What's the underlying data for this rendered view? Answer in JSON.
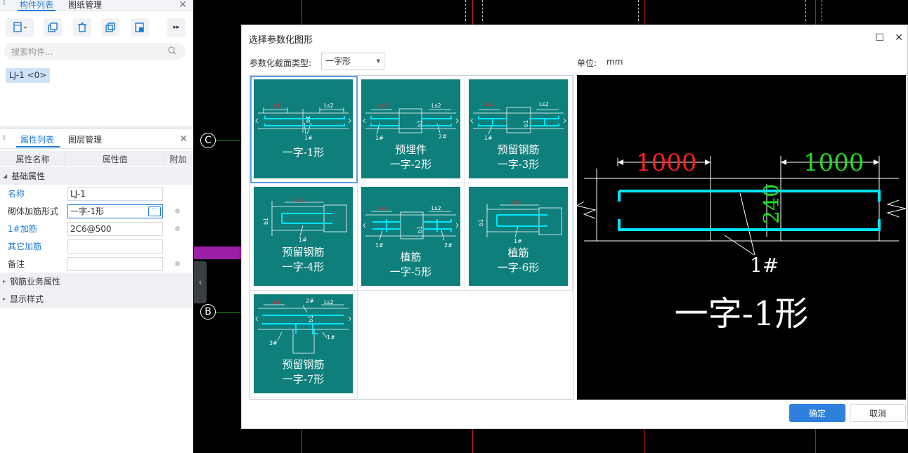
{
  "left_panel": {
    "top_tabs": [
      "构件列表",
      "图纸管理"
    ],
    "search_placeholder": "搜索构件...",
    "component_tag": "LJ-1 <0>",
    "prop_tabs": [
      "属性列表",
      "图层管理"
    ],
    "table_headers": [
      "属性名称",
      "属性值",
      "附加"
    ],
    "group_basic": "基础属性",
    "properties": [
      {
        "name": "名称",
        "value": "LJ-1",
        "highlight": true
      },
      {
        "name": "砌体加筋形式",
        "value": "一字-1形",
        "highlight": false
      },
      {
        "name": "1#加筋",
        "value": "2C6@500",
        "highlight": true
      },
      {
        "name": "其它加筋",
        "value": "",
        "highlight": true
      },
      {
        "name": "备注",
        "value": "",
        "highlight": false
      }
    ],
    "group_rebar": "钢筋业务属性",
    "group_display": "显示样式"
  },
  "cad": {
    "axis_labels": [
      "C",
      "B"
    ]
  },
  "dialog": {
    "title": "选择参数化图形",
    "type_label": "参数化截面类型:",
    "type_value": "一字形",
    "unit_label": "单位:",
    "unit_value": "mm",
    "thumbnails": [
      {
        "caption": [
          "一字-1形"
        ],
        "id": "1"
      },
      {
        "caption": [
          "预埋件",
          "一字-2形"
        ],
        "id": "2"
      },
      {
        "caption": [
          "预留钢筋",
          "一字-3形"
        ],
        "id": "3"
      },
      {
        "caption": [
          "预留钢筋",
          "一字-4形"
        ],
        "id": "4"
      },
      {
        "caption": [
          "植筋",
          "一字-5形"
        ],
        "id": "5"
      },
      {
        "caption": [
          "植筋",
          "一字-6形"
        ],
        "id": "6"
      },
      {
        "caption": [
          "预留钢筋",
          "一字-7形"
        ],
        "id": "7"
      }
    ],
    "thumb_labels": {
      "ls1": "Ls1",
      "ls2": "Ls2",
      "b1": "b1",
      "r1": "1#",
      "r2": "2#",
      "r3": "3#"
    },
    "preview": {
      "dim_left": "1000",
      "dim_right": "1000",
      "dim_height": "240",
      "rebar_label": "1#",
      "shape_name": "一字-1形"
    },
    "ok_label": "确定",
    "cancel_label": "取消"
  },
  "colors": {
    "accent": "#1e78d7",
    "thumb_bg": "#0f7f7c",
    "rebar_cyan": "#00e5ff",
    "dim_red": "#ff2020",
    "dim_green": "#22dd22"
  }
}
